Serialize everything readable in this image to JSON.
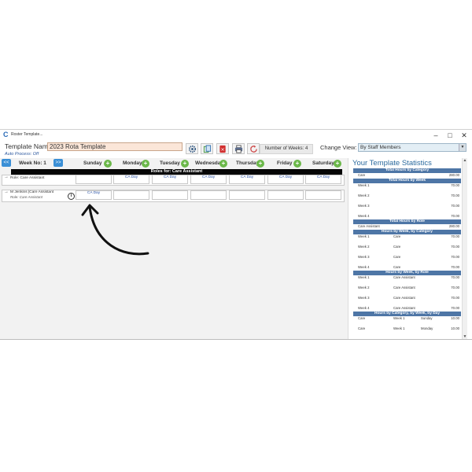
{
  "window": {
    "title": "Roster Template...",
    "controls": {
      "minimize": "–",
      "maximize": "□",
      "close": "✕"
    }
  },
  "header": {
    "template_name_label": "Template Name:",
    "template_name_value": "2023 Rota Template",
    "auto_process": "Auto Process: Off",
    "number_of_weeks": "Number of Weeks: 4",
    "change_view_label": "Change View:",
    "change_view_value": "By Staff Members"
  },
  "grid": {
    "prev_label": "<<",
    "next_label": ">>",
    "week_no": "Week No: 1",
    "days": [
      "Sunday",
      "Monday",
      "Tuesday",
      "Wednesday",
      "Thursday",
      "Friday",
      "Saturday"
    ],
    "roles_bar": "Roles for: Care Assistant",
    "role_row": {
      "label": "Role: Care Assistant",
      "cells": [
        "",
        "CA Day",
        "CA Day",
        "CA Day",
        "CA Day",
        "CA Day",
        "CA Day"
      ]
    },
    "staff_row": {
      "label": "M Jenkins |Care Assistant",
      "sub": "Role: Care Assistant",
      "cells": [
        "CA Day",
        "",
        "",
        "",
        "",
        "",
        ""
      ]
    }
  },
  "stats": {
    "title": "Your Template Statistics",
    "total_by_category": {
      "head": "Total Hours by Category",
      "rows": [
        {
          "label": "Care",
          "value": "280.00"
        }
      ]
    },
    "total_by_week": {
      "head": "Total Hours by Week",
      "rows": [
        {
          "label": "Week 1",
          "value": "70.00"
        },
        {
          "label": "Week 2",
          "value": "70.00"
        },
        {
          "label": "Week 3",
          "value": "70.00"
        },
        {
          "label": "Week 4",
          "value": "70.00"
        }
      ]
    },
    "total_by_role": {
      "head": "Total Hours by Role",
      "rows": [
        {
          "label": "Care Assistant",
          "value": "280.00"
        }
      ]
    },
    "by_week_category": {
      "head": "Hours by Week, by Category",
      "rows": [
        {
          "week": "Week 1",
          "cat": "Care",
          "value": "70.00"
        },
        {
          "week": "Week 2",
          "cat": "Care",
          "value": "70.00"
        },
        {
          "week": "Week 3",
          "cat": "Care",
          "value": "70.00"
        },
        {
          "week": "Week 4",
          "cat": "Care",
          "value": "70.00"
        }
      ]
    },
    "by_week_role": {
      "head": "Hours by Week, by Role",
      "rows": [
        {
          "week": "Week 1",
          "role": "Care Assistant",
          "value": "70.00"
        },
        {
          "week": "Week 2",
          "role": "Care Assistant",
          "value": "70.00"
        },
        {
          "week": "Week 3",
          "role": "Care Assistant",
          "value": "70.00"
        },
        {
          "week": "Week 4",
          "role": "Care Assistant",
          "value": "70.00"
        }
      ]
    },
    "by_cat_week_day": {
      "head": "Hours by Category, by Week, by Day",
      "rows": [
        {
          "cat": "Care",
          "week": "Week 1",
          "day": "Sunday",
          "value": "10.00"
        },
        {
          "cat": "Care",
          "week": "Week 1",
          "day": "Monday",
          "value": "10.00"
        }
      ]
    }
  }
}
